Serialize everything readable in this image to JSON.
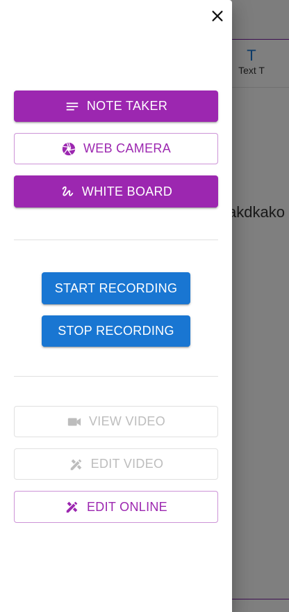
{
  "background": {
    "tool_glyph": "T",
    "tool_label": "Text T",
    "content_text": "akdkako"
  },
  "drawer": {
    "close_icon": "close-icon",
    "note_taker": {
      "label": "NOTE TAKER",
      "icon": "notes-icon"
    },
    "web_camera": {
      "label": "WEB CAMERA",
      "icon": "camera-shutter-icon"
    },
    "white_board": {
      "label": "WHITE BOARD",
      "icon": "gesture-icon"
    },
    "start_recording": {
      "label": "START RECORDING"
    },
    "stop_recording": {
      "label": "STOP RECORDING"
    },
    "view_video": {
      "label": "VIEW VIDEO",
      "icon": "videocam-icon"
    },
    "edit_video": {
      "label": "EDIT VIDEO",
      "icon": "design-services-icon"
    },
    "edit_online": {
      "label": "EDIT ONLINE",
      "icon": "design-services-icon"
    }
  },
  "colors": {
    "purple": "#9c27b0",
    "blue": "#1976d2",
    "disabled": "#bdbdbd",
    "scrim": "rgba(0,0,0,0.5)"
  }
}
